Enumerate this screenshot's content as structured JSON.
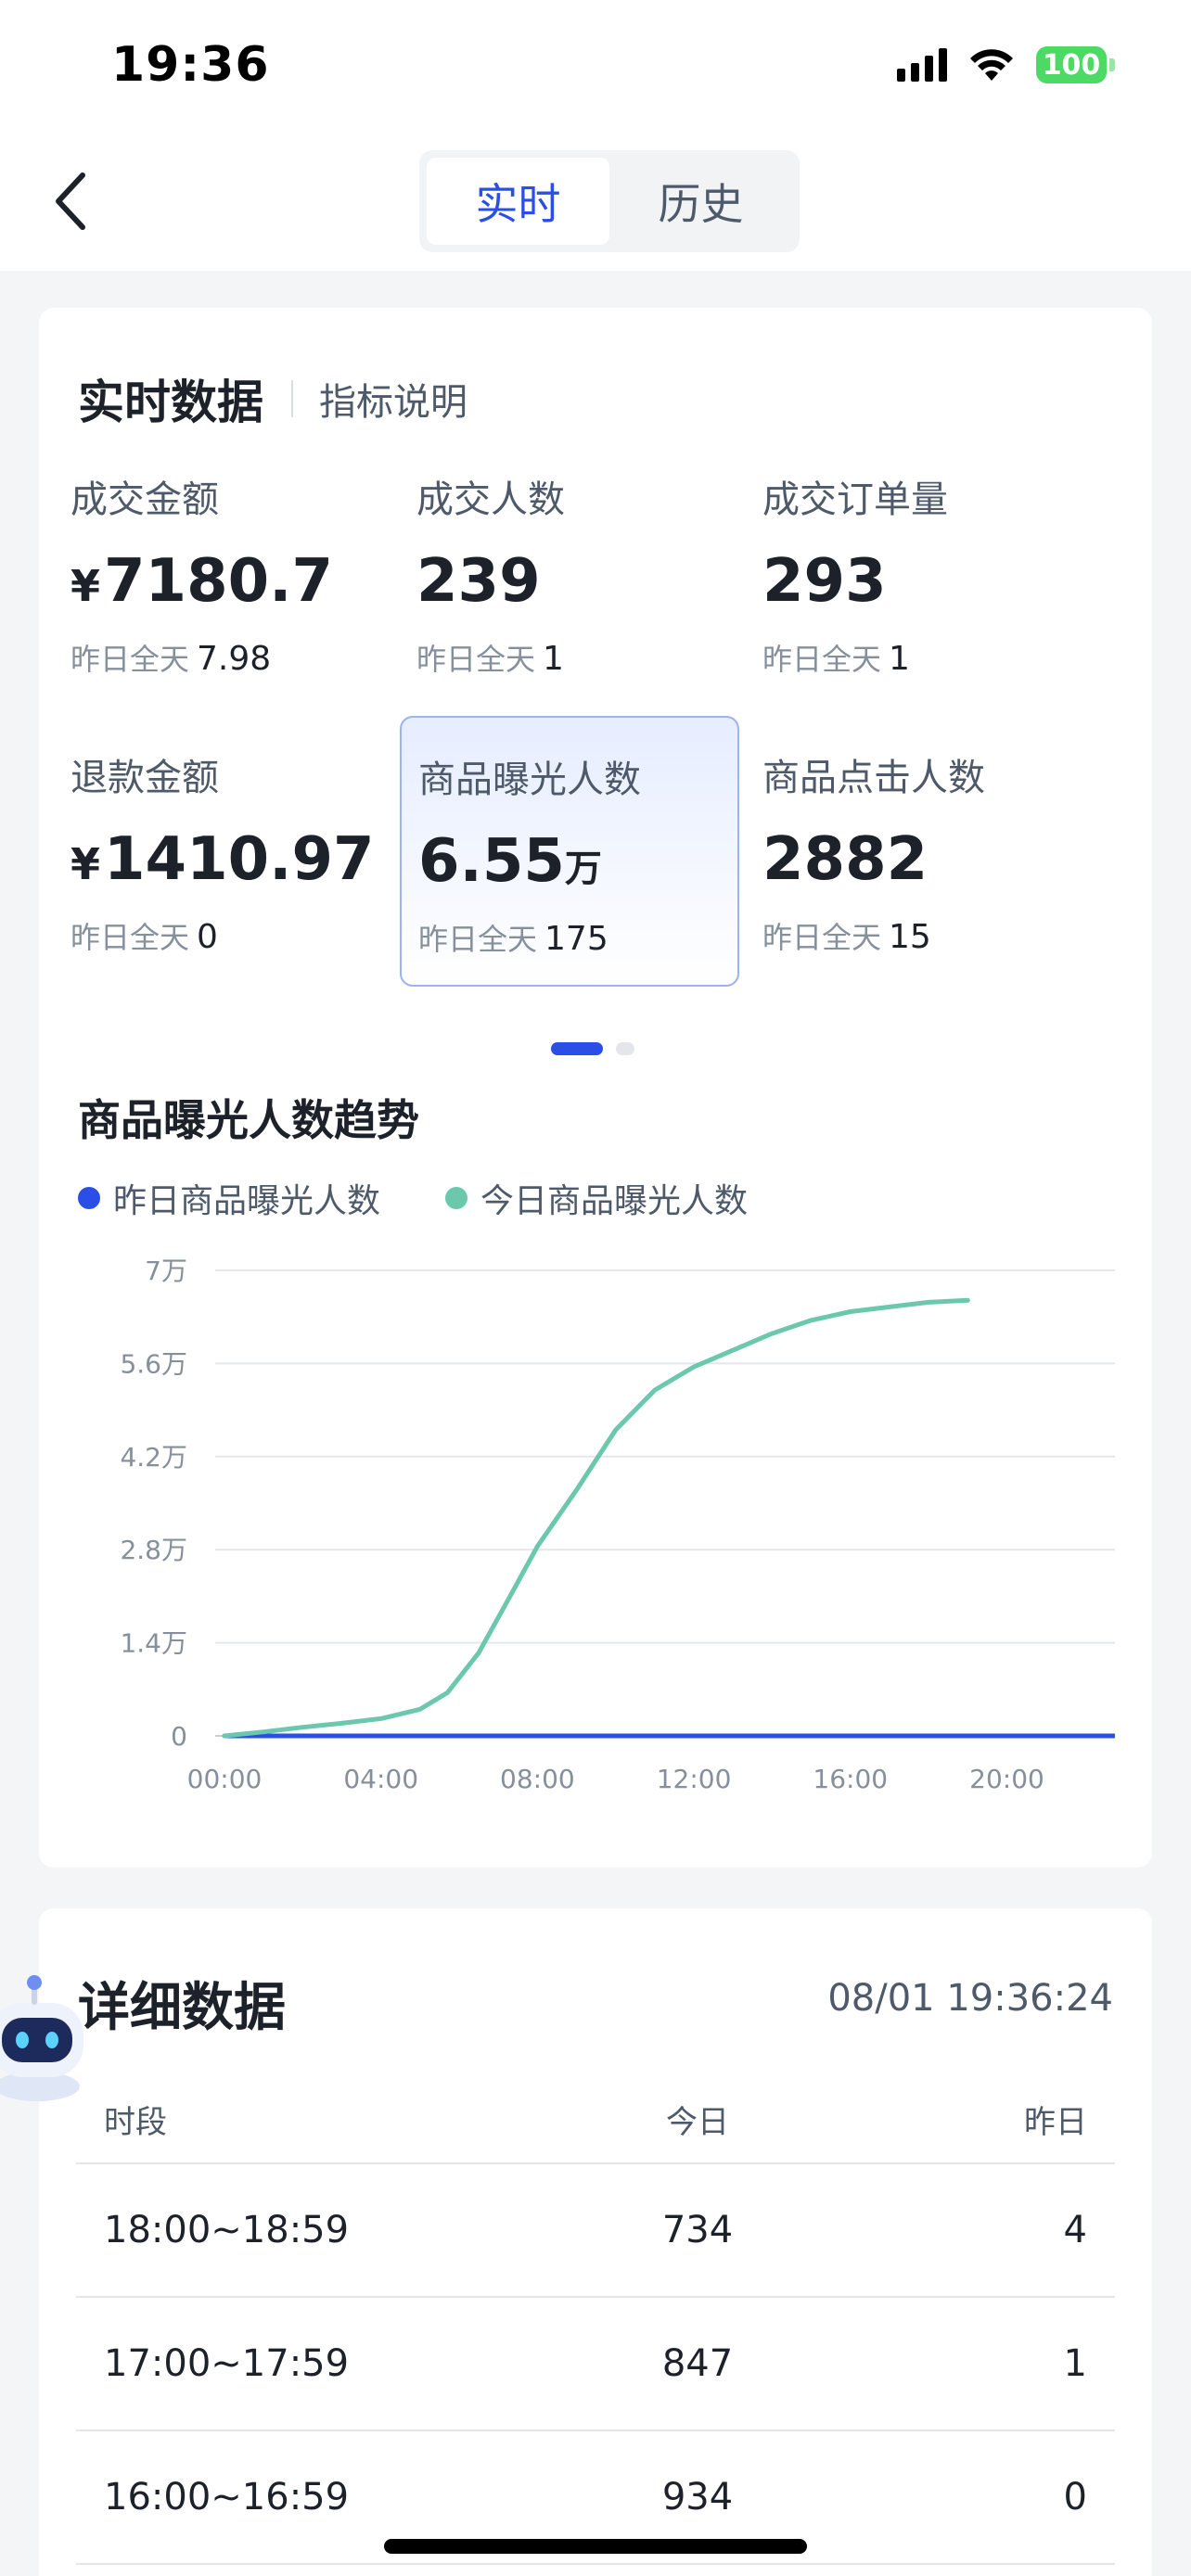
{
  "status_bar": {
    "time": "19:36",
    "battery": "100"
  },
  "nav": {
    "tabs": [
      {
        "label": "实时",
        "active": true
      },
      {
        "label": "历史",
        "active": false
      }
    ]
  },
  "realtime": {
    "title": "实时数据",
    "help_link": "指标说明",
    "compare_label": "昨日全天",
    "metrics": [
      {
        "label": "成交金额",
        "currency": "¥",
        "value": "7180.7",
        "unit": "",
        "compare": "7.98",
        "selected": false
      },
      {
        "label": "成交人数",
        "currency": "",
        "value": "239",
        "unit": "",
        "compare": "1",
        "selected": false
      },
      {
        "label": "成交订单量",
        "currency": "",
        "value": "293",
        "unit": "",
        "compare": "1",
        "selected": false
      },
      {
        "label": "退款金额",
        "currency": "¥",
        "value": "1410.97",
        "unit": "",
        "compare": "0",
        "selected": false
      },
      {
        "label": "商品曝光人数",
        "currency": "",
        "value": "6.55",
        "unit": "万",
        "compare": "175",
        "selected": true
      },
      {
        "label": "商品点击人数",
        "currency": "",
        "value": "2882",
        "unit": "",
        "compare": "15",
        "selected": false
      }
    ],
    "pager": {
      "pages": 2,
      "current": 0
    }
  },
  "trend": {
    "title": "商品曝光人数趋势",
    "legend": [
      {
        "name": "昨日商品曝光人数",
        "color": "#2b4ee6"
      },
      {
        "name": "今日商品曝光人数",
        "color": "#6cc8ad"
      }
    ]
  },
  "chart_data": {
    "type": "line",
    "title": "商品曝光人数趋势",
    "xlabel": "",
    "ylabel": "",
    "x_ticks": [
      "00:00",
      "04:00",
      "08:00",
      "12:00",
      "16:00",
      "20:00"
    ],
    "y_ticks": [
      {
        "value": 0,
        "label": "0"
      },
      {
        "value": 14000,
        "label": "1.4万"
      },
      {
        "value": 28000,
        "label": "2.8万"
      },
      {
        "value": 42000,
        "label": "4.2万"
      },
      {
        "value": 56000,
        "label": "5.6万"
      },
      {
        "value": 70000,
        "label": "7万"
      }
    ],
    "xlim": [
      0,
      23
    ],
    "ylim": [
      0,
      70000
    ],
    "grid": true,
    "legend_position": "top-left",
    "series": [
      {
        "name": "昨日商品曝光人数",
        "color": "#2b4ee6",
        "x": [
          0,
          23
        ],
        "y": [
          0,
          0
        ]
      },
      {
        "name": "今日商品曝光人数",
        "color": "#6cc8ad",
        "x": [
          0,
          1,
          2,
          3,
          4,
          5,
          5.7,
          6.5,
          7.3,
          8,
          9,
          10,
          11,
          12,
          13,
          14,
          15,
          16,
          17,
          18,
          19
        ],
        "y": [
          0,
          600,
          1300,
          1900,
          2600,
          4000,
          6500,
          12500,
          21000,
          28500,
          37000,
          46000,
          52000,
          55500,
          58000,
          60500,
          62500,
          63800,
          64500,
          65200,
          65500
        ]
      }
    ]
  },
  "detail": {
    "title": "详细数据",
    "timestamp": "08/01 19:36:24",
    "columns": {
      "period": "时段",
      "today": "今日",
      "yesterday": "昨日"
    },
    "rows": [
      {
        "period": "18:00~18:59",
        "today": "734",
        "yesterday": "4"
      },
      {
        "period": "17:00~17:59",
        "today": "847",
        "yesterday": "1"
      },
      {
        "period": "16:00~16:59",
        "today": "934",
        "yesterday": "0"
      }
    ]
  }
}
